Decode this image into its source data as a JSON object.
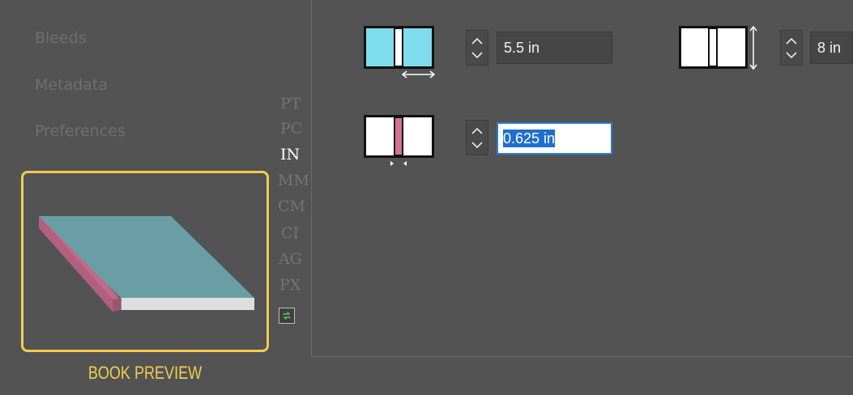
{
  "sidebar": {
    "items": [
      {
        "label": "Bleeds"
      },
      {
        "label": "Metadata"
      },
      {
        "label": "Preferences"
      }
    ],
    "preview_label": "BOOK PREVIEW"
  },
  "units": {
    "options": [
      "PT",
      "PC",
      "IN",
      "MM",
      "CM",
      "CI",
      "AG",
      "PX"
    ],
    "active": "IN"
  },
  "dimensions": {
    "width": {
      "value": "5.5 in",
      "icon": "page-width-icon"
    },
    "height": {
      "value": "8 in",
      "icon": "page-height-icon"
    },
    "spine": {
      "value": "0.625 in",
      "icon": "spine-width-icon"
    }
  },
  "colors": {
    "accent": "#f2cd4d",
    "page_fill": "#7fdcef",
    "spine": "#d6718f",
    "selection": "#1f6fd1",
    "book_cover": "#6a9ea6"
  }
}
